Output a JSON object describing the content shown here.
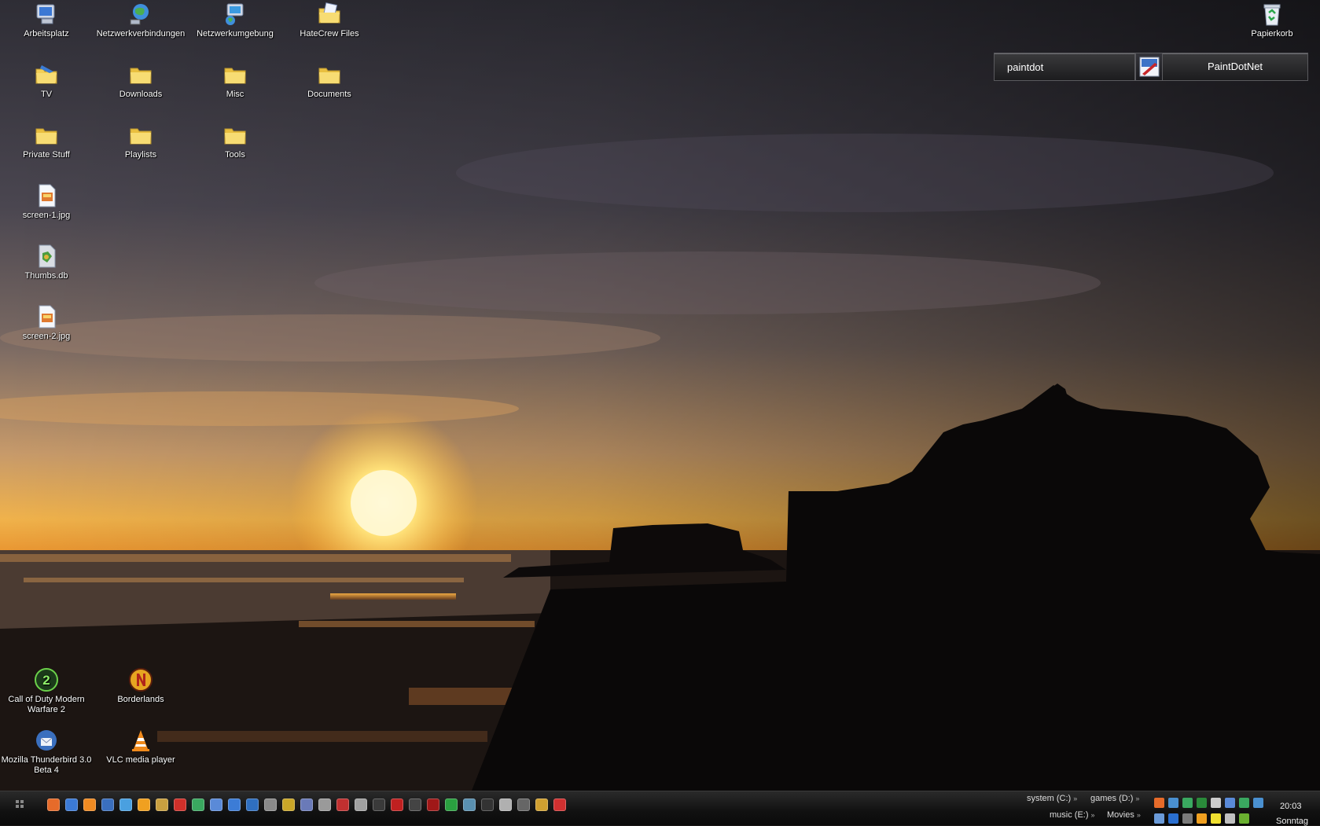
{
  "desktop": {
    "icons": [
      {
        "label": "Arbeitsplatz",
        "icon": "computer-icon"
      },
      {
        "label": "Netzwerkverbindungen",
        "icon": "network-connections-icon"
      },
      {
        "label": "Netzwerkumgebung",
        "icon": "network-places-icon"
      },
      {
        "label": "HateCrew Files",
        "icon": "folder-shared-icon"
      },
      {
        "label": "TV",
        "icon": "folder-tv-icon"
      },
      {
        "label": "Downloads",
        "icon": "folder-icon"
      },
      {
        "label": "Misc",
        "icon": "folder-icon"
      },
      {
        "label": "Documents",
        "icon": "folder-icon"
      },
      {
        "label": "Private Stuff",
        "icon": "folder-icon"
      },
      {
        "label": "Playlists",
        "icon": "folder-icon"
      },
      {
        "label": "Tools",
        "icon": "folder-icon"
      },
      {
        "label": "screen-1.jpg",
        "icon": "image-file-icon"
      },
      {
        "label": "Thumbs.db",
        "icon": "db-file-icon"
      },
      {
        "label": "screen-2.jpg",
        "icon": "image-file-icon"
      },
      {
        "label": "Papierkorb",
        "icon": "recycle-bin-icon"
      },
      {
        "label": "Call of Duty Modern Warfare 2",
        "icon": "cod-mw2-icon"
      },
      {
        "label": "Borderlands",
        "icon": "borderlands-icon"
      },
      {
        "label": "Mozilla Thunderbird 3.0 Beta 4",
        "icon": "thunderbird-icon"
      },
      {
        "label": "VLC media player",
        "icon": "vlc-icon"
      }
    ]
  },
  "launcher": {
    "query": "paintdot",
    "result": "PaintDotNet",
    "result_icon": "paintdotnet-icon"
  },
  "taskbar": {
    "drives": [
      {
        "label": "system (C:)"
      },
      {
        "label": "games (D:)"
      },
      {
        "label": "music (E:)"
      },
      {
        "label": "Movies"
      }
    ],
    "clock": {
      "time": "20:03",
      "day": "Sonntag"
    },
    "quicklaunch": [
      "firefox-icon",
      "ie-icon",
      "firefox-alt-icon",
      "thunderbird-icon",
      "network-icon",
      "winamp-icon",
      "pen-icon",
      "flag-icon",
      "globe-icon",
      "steam-icon",
      "skype-icon",
      "teamspeak-icon",
      "skull-icon",
      "wow-icon",
      "ventrilo-icon",
      "reaper-icon",
      "dots-icon",
      "ghost-icon",
      "xfire-icon",
      "stop-icon",
      "shield-icon",
      "red-icon",
      "star-icon",
      "cube-icon",
      "arrow-icon",
      "pin-icon",
      "eac-icon",
      "tool-icon",
      "flag-fr-icon"
    ],
    "tray_icons": [
      "firefox-tray-icon",
      "network-tray-icon",
      "chart-tray-icon",
      "monitor-tray-icon",
      "skull-tray-icon",
      "display-tray-icon",
      "grid-tray-icon",
      "globe-tray-icon",
      "computer-tray-icon",
      "bluetooth-tray-icon",
      "antivirus-tray-icon",
      "warning-tray-icon",
      "note-tray-icon",
      "volume-tray-icon",
      "nvidia-tray-icon"
    ]
  },
  "colors": {
    "folder": "#f3cf55",
    "taskbar": "#111111",
    "accent_sun": "#ffd65a"
  }
}
